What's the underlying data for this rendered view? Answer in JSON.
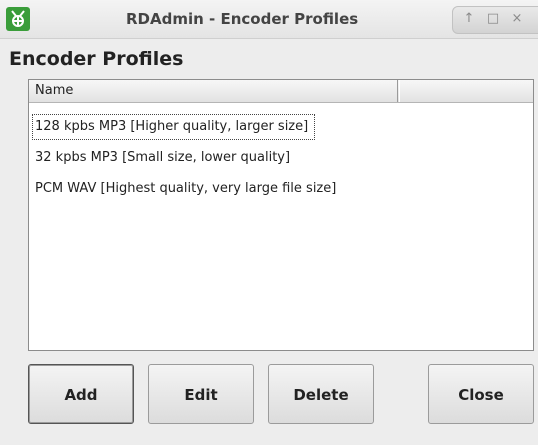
{
  "window": {
    "title": "RDAdmin - Encoder Profiles",
    "icon": "rdadmin-app-icon",
    "controls": {
      "up": "↑",
      "maximize": "□",
      "close": "×"
    }
  },
  "heading": "Encoder Profiles",
  "list": {
    "columns": [
      "Name",
      ""
    ],
    "rows": [
      "128 kpbs MP3 [Higher quality, larger size]",
      "32 kpbs MP3 [Small size, lower quality]",
      "PCM WAV [Highest quality, very large file size]"
    ],
    "focused_index": 0
  },
  "buttons": {
    "add": "Add",
    "edit": "Edit",
    "delete": "Delete",
    "close": "Close"
  },
  "colors": {
    "icon": "#3a9d3a",
    "window_bg": "#ededed"
  }
}
